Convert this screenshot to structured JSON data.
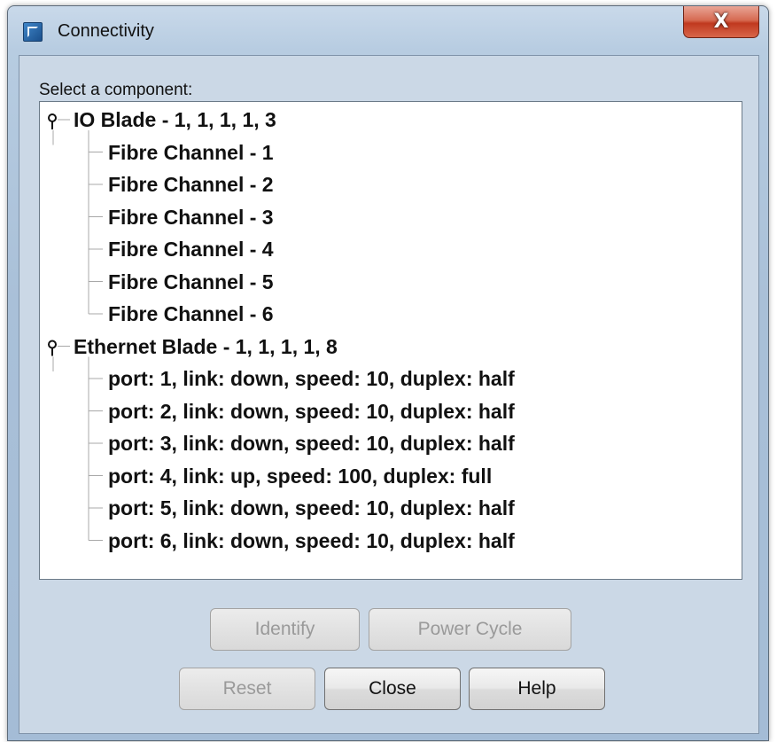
{
  "window": {
    "title": "Connectivity",
    "close_glyph": "X"
  },
  "dialog": {
    "select_label": "Select a component:"
  },
  "tree": {
    "nodes": [
      {
        "label": "IO Blade - 1, 1, 1, 1, 3",
        "expanded": true,
        "children": [
          "Fibre Channel - 1",
          "Fibre Channel - 2",
          "Fibre Channel - 3",
          "Fibre Channel - 4",
          "Fibre Channel - 5",
          "Fibre Channel - 6"
        ]
      },
      {
        "label": "Ethernet Blade - 1, 1, 1, 1, 8",
        "expanded": true,
        "children": [
          "port: 1, link: down, speed: 10, duplex: half",
          "port: 2, link: down, speed: 10, duplex: half",
          "port: 3, link: down, speed: 10, duplex: half",
          "port: 4, link: up, speed: 100, duplex: full",
          "port: 5, link: down, speed: 10, duplex: half",
          "port: 6, link: down, speed: 10, duplex: half"
        ]
      }
    ]
  },
  "buttons": {
    "identify": {
      "label": "Identify",
      "enabled": false
    },
    "power_cycle": {
      "label": "Power Cycle",
      "enabled": false
    },
    "reset": {
      "label": "Reset",
      "enabled": false
    },
    "close": {
      "label": "Close",
      "enabled": true
    },
    "help": {
      "label": "Help",
      "enabled": true
    }
  },
  "icons": {
    "app": "app-icon",
    "expand": "expanded-handle-icon",
    "close": "close-icon"
  }
}
